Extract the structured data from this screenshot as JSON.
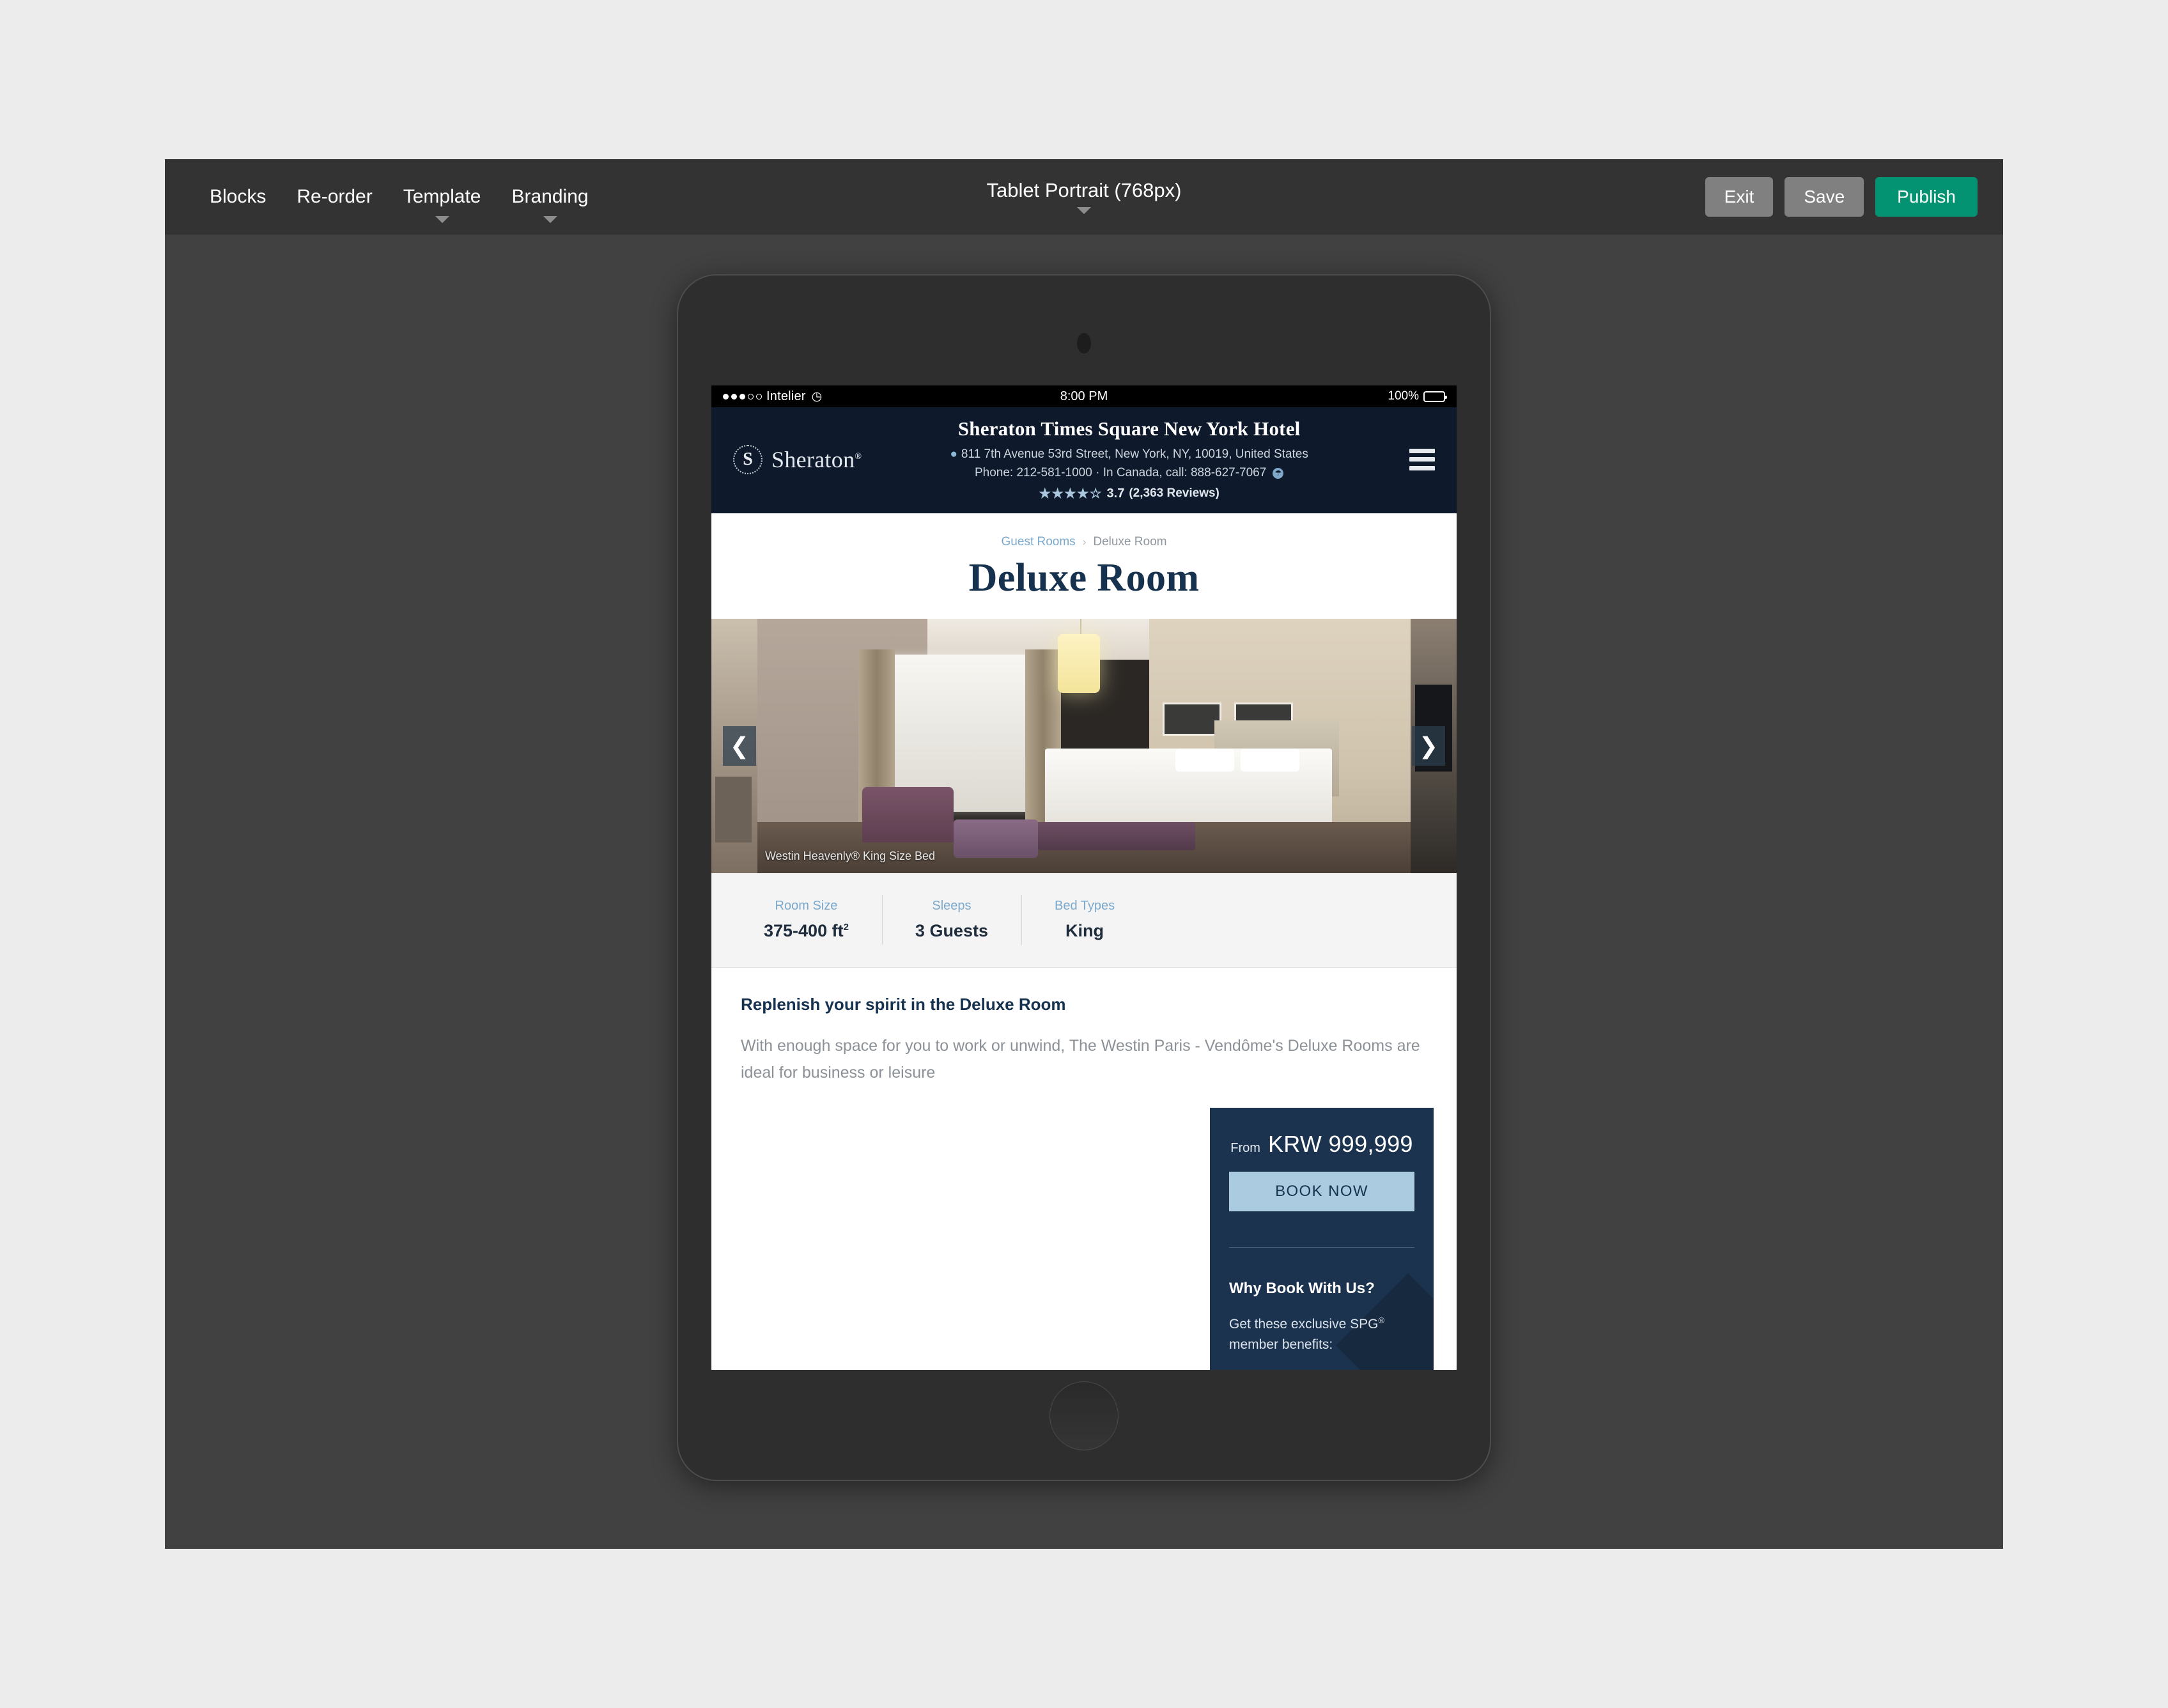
{
  "toolbar": {
    "menu": [
      {
        "label": "Blocks",
        "has_caret": false
      },
      {
        "label": "Re-order",
        "has_caret": false
      },
      {
        "label": "Template",
        "has_caret": true
      },
      {
        "label": "Branding",
        "has_caret": true
      }
    ],
    "viewport_label": "Tablet Portrait (768px)",
    "exit_label": "Exit",
    "save_label": "Save",
    "publish_label": "Publish",
    "publish_color": "#049372",
    "bar_color": "#333333"
  },
  "canvas": {
    "background": "#414141",
    "page_background": "#ececec"
  },
  "statusbar": {
    "carrier": "Intelier",
    "wifi_icon": "wifi-icon",
    "time": "8:00 PM",
    "battery_percent": "100%"
  },
  "hotel_header": {
    "background": "#0e1a2b",
    "brand_mark": "S",
    "brand_name": "Sheraton",
    "brand_trademark": "®",
    "name": "Sheraton Times Square New York Hotel",
    "address": "811 7th Avenue 53rd Street, New York, NY, 10019, United States",
    "phone_line": "Phone: 212-581-1000  ·  In Canada, call: 888-627-7067",
    "stars_filled": 4,
    "stars_total": 5,
    "stars_glyphs": "★★★★☆",
    "rating": "3.7",
    "review_count": "(2,363 Reviews)",
    "menu_icon": "hamburger-icon"
  },
  "page": {
    "breadcrumb_parent": "Guest Rooms",
    "breadcrumb_separator": "›",
    "breadcrumb_current": "Deluxe Room",
    "title": "Deluxe Room"
  },
  "gallery": {
    "caption": "Westin Heavenly® King Size Bed",
    "prev_icon": "chevron-left-icon",
    "next_icon": "chevron-right-icon"
  },
  "specs": [
    {
      "label": "Room Size",
      "value": "375-400 ft",
      "superscript": "2"
    },
    {
      "label": "Sleeps",
      "value": "3 Guests",
      "superscript": ""
    },
    {
      "label": "Bed Types",
      "value": "King",
      "superscript": ""
    }
  ],
  "description": {
    "heading": "Replenish your spirit in the Deluxe Room",
    "body": "With enough space for you to work or unwind, The Westin Paris - Vendôme's Deluxe Rooms are ideal for business or leisure"
  },
  "booking": {
    "from_label": "From",
    "price": "KRW 999,999",
    "book_now_label": "BOOK NOW",
    "book_now_color": "#aacbe0",
    "panel_color": "#1c3350",
    "why_title": "Why Book With Us?",
    "why_subtitle": "Get these exclusive SPG",
    "why_subtitle_sup": "®",
    "why_subtitle_tail": " member benefits:"
  }
}
